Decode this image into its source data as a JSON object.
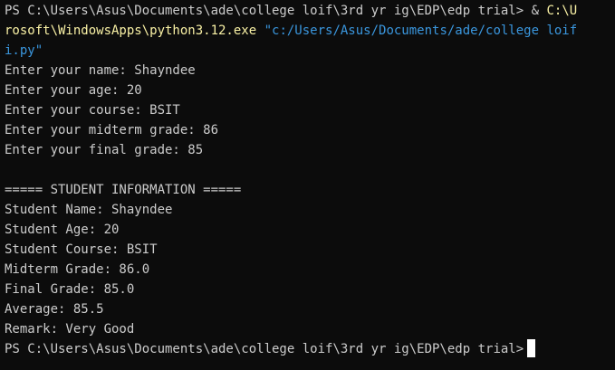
{
  "terminal": {
    "prompt": "PS C:\\Users\\Asus\\Documents\\ade\\college loif\\3rd yr ig\\EDP\\edp trial>",
    "command_op": " & ",
    "command_exe_line1": "C:\\U",
    "command_exe_line2": "rosoft\\WindowsApps\\python3.12.exe",
    "command_arg_line2": " \"c:/Users/Asus/Documents/ade/college loif",
    "command_arg_line3": "i.py\"",
    "inputs": [
      "Enter your name: Shayndee",
      "Enter your age: 20",
      "Enter your course: BSIT",
      "Enter your midterm grade: 86",
      "Enter your final grade: 85"
    ],
    "header": "===== STUDENT INFORMATION =====",
    "outputs": [
      "Student Name: Shayndee",
      "Student Age: 20",
      "Student Course: BSIT",
      "Midterm Grade: 86.0",
      "Final Grade: 85.0",
      "Average: 85.5",
      "Remark: Very Good"
    ],
    "final_prompt": "PS C:\\Users\\Asus\\Documents\\ade\\college loif\\3rd yr ig\\EDP\\edp trial>"
  },
  "colors": {
    "background": "#0c0c0c",
    "text": "#cccccc",
    "command": "#f9f1a5",
    "string": "#3a96dd"
  }
}
